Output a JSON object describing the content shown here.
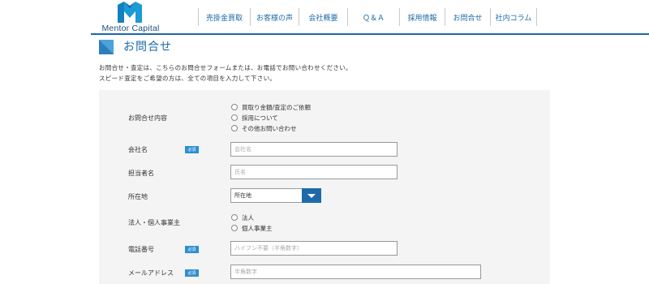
{
  "header": {
    "logo_text": "Mentor Capital",
    "brand_color": "#1b6aa8",
    "nav": [
      {
        "label": "売掛金買取"
      },
      {
        "label": "お客様の声"
      },
      {
        "label": "会社概要"
      },
      {
        "label": "Ｑ＆Ａ"
      },
      {
        "label": "採用情報"
      },
      {
        "label": "お問合せ"
      },
      {
        "label": "社内コラム"
      }
    ]
  },
  "page": {
    "title": "お問合せ",
    "intro_line1": "お問合せ・査定は、こちらのお問合せフォームまたは、お電話でお問い合わせください。",
    "intro_line2": "スピード査定をご希望の方は、全ての項目を入力して下さい。"
  },
  "form": {
    "required_badge": "必須",
    "inquiry": {
      "label": "お問合せ内容",
      "options": [
        "買取り金額/査定のご依頼",
        "採用について",
        "その他お問い合わせ"
      ]
    },
    "company": {
      "label": "会社名",
      "placeholder": "会社名",
      "value": ""
    },
    "contact_person": {
      "label": "担当者名",
      "placeholder": "氏名",
      "value": ""
    },
    "location": {
      "label": "所在地",
      "selected": "所在地"
    },
    "entity_type": {
      "label": "法人・個人事業主",
      "options": [
        "法人",
        "個人事業主"
      ]
    },
    "phone": {
      "label": "電話番号",
      "placeholder": "ハイフン不要（半角数字）",
      "value": ""
    },
    "email": {
      "label": "メールアドレス",
      "placeholder": "半角数字",
      "value": ""
    }
  }
}
